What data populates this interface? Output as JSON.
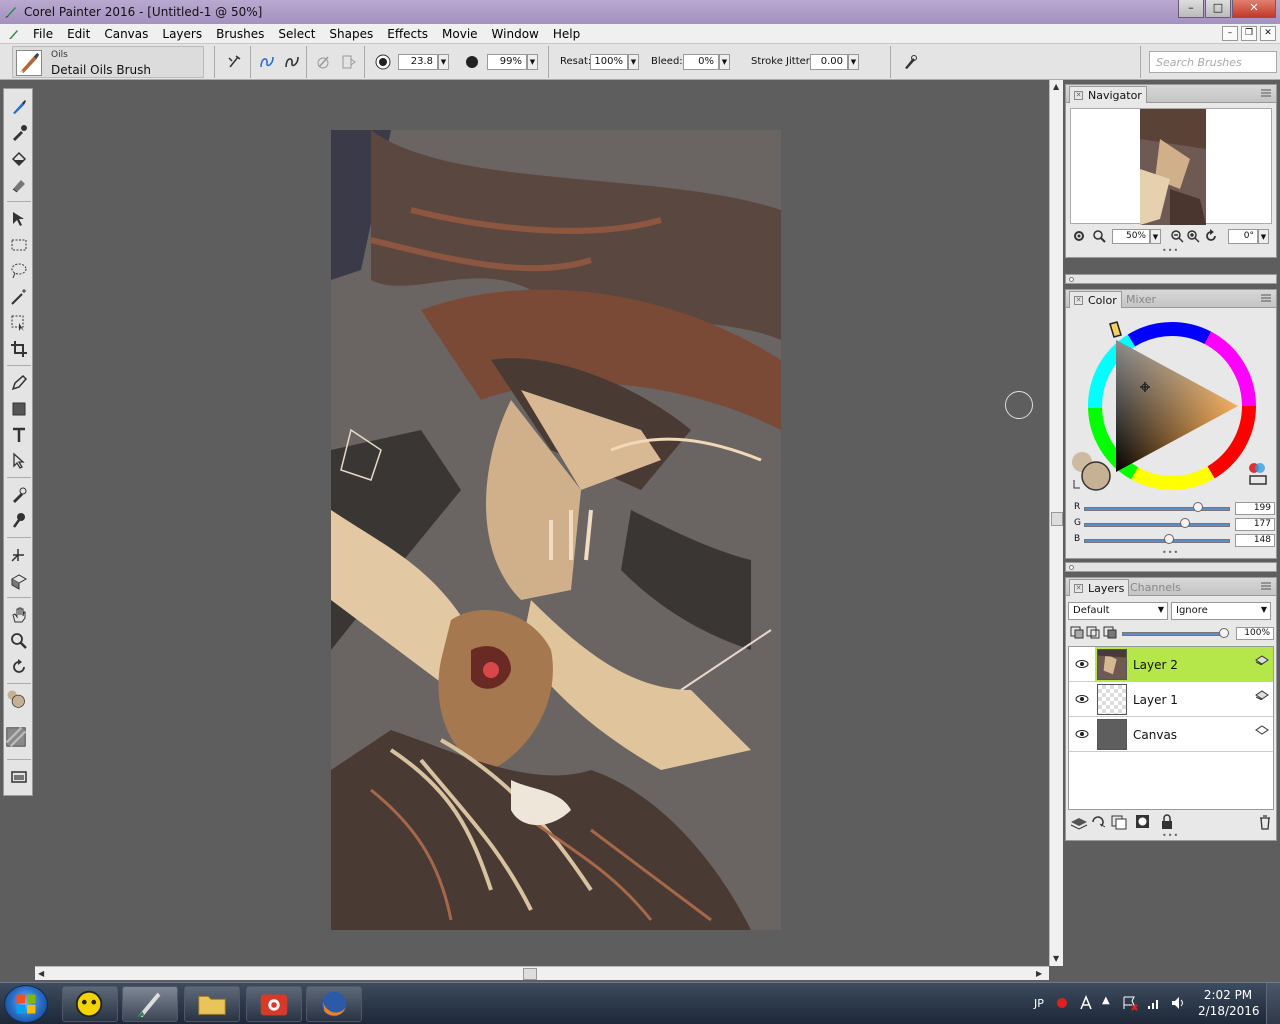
{
  "window": {
    "title": "Corel Painter 2016 - [Untitled-1 @ 50%]"
  },
  "menu": [
    "File",
    "Edit",
    "Canvas",
    "Layers",
    "Brushes",
    "Select",
    "Shapes",
    "Effects",
    "Movie",
    "Window",
    "Help"
  ],
  "property_bar": {
    "brush_category": "Oils",
    "brush_variant": "Detail Oils Brush",
    "size": "23.8",
    "opacity": "99%",
    "resat_label": "Resat:",
    "resat": "100%",
    "bleed_label": "Bleed:",
    "bleed": "0%",
    "stroke_jitter_label": "Stroke Jitter:",
    "stroke_jitter": "0.00",
    "search_placeholder": "Search Brushes"
  },
  "navigator": {
    "title": "Navigator",
    "zoom": "50%",
    "rotation": "0°"
  },
  "color_panel": {
    "tab_color": "Color",
    "tab_mixer": "Mixer",
    "r": "199",
    "g": "177",
    "b": "148",
    "r_label": "R",
    "g_label": "G",
    "b_label": "B",
    "r_fraction": 0.78,
    "g_fraction": 0.69,
    "b_fraction": 0.58,
    "current_color": "#c7b194"
  },
  "layers_panel": {
    "tab_layers": "Layers",
    "tab_channels": "Channels",
    "composite_method": "Default",
    "preserve": "Ignore",
    "opacity": "100%",
    "layers": [
      {
        "name": "Layer 2",
        "selected": true
      },
      {
        "name": "Layer 1",
        "selected": false
      },
      {
        "name": "Canvas",
        "selected": false
      }
    ]
  },
  "taskbar": {
    "lang": "JP",
    "time": "2:02 PM",
    "date": "2/18/2016"
  }
}
